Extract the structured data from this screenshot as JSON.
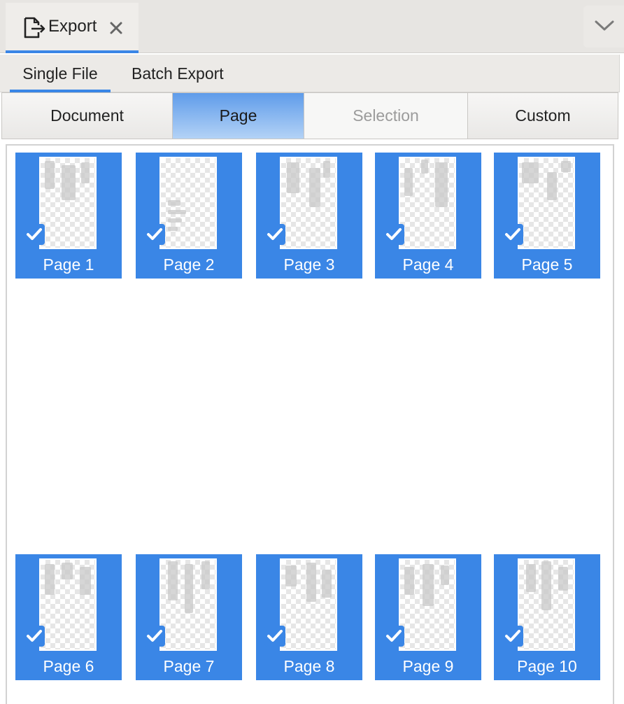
{
  "panel": {
    "title": "Export",
    "title_icon": "export-icon",
    "close_icon": "close-icon",
    "collapse_icon": "chevron-down-icon"
  },
  "subtabs": [
    {
      "label": "Single File",
      "active": true
    },
    {
      "label": "Batch Export",
      "active": false
    }
  ],
  "scope": {
    "document": "Document",
    "page": "Page",
    "selection": "Selection",
    "custom": "Custom",
    "selected": "Page",
    "disabled": [
      "Selection"
    ]
  },
  "pages": [
    {
      "label": "Page 1",
      "checked": true
    },
    {
      "label": "Page 2",
      "checked": true
    },
    {
      "label": "Page 3",
      "checked": true
    },
    {
      "label": "Page 4",
      "checked": true
    },
    {
      "label": "Page 5",
      "checked": true
    },
    {
      "label": "Page 6",
      "checked": true
    },
    {
      "label": "Page 7",
      "checked": true
    },
    {
      "label": "Page 8",
      "checked": true
    },
    {
      "label": "Page 9",
      "checked": true
    },
    {
      "label": "Page 10",
      "checked": true
    }
  ],
  "colors": {
    "accent": "#3a86e6",
    "tab_bar_bg": "#e7e5e2",
    "disabled_text": "#9b9b9b"
  }
}
